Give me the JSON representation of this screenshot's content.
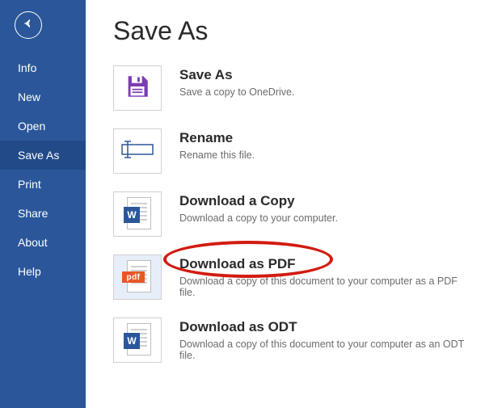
{
  "page": {
    "title": "Save As"
  },
  "sidebar": {
    "items": [
      {
        "label": "Info"
      },
      {
        "label": "New"
      },
      {
        "label": "Open"
      },
      {
        "label": "Save As"
      },
      {
        "label": "Print"
      },
      {
        "label": "Share"
      },
      {
        "label": "About"
      },
      {
        "label": "Help"
      }
    ],
    "active_index": 3
  },
  "options": [
    {
      "title": "Save As",
      "desc": "Save a copy to OneDrive."
    },
    {
      "title": "Rename",
      "desc": "Rename this file."
    },
    {
      "title": "Download a Copy",
      "desc": "Download a copy to your computer."
    },
    {
      "title": "Download as PDF",
      "desc": "Download a copy of this document to your computer as a PDF file."
    },
    {
      "title": "Download as ODT",
      "desc": "Download a copy of this document to your computer as an ODT file."
    }
  ],
  "selected_option_index": 3,
  "annotation": {
    "highlight_option_index": 3
  }
}
